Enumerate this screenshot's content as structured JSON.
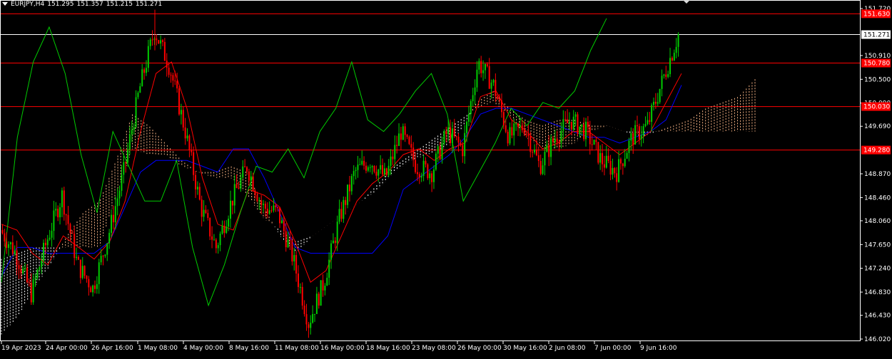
{
  "header": {
    "symbol": "EURJPY,H4",
    "open": "151.295",
    "high": "151.357",
    "low": "151.215",
    "close": "151.271"
  },
  "colors": {
    "background": "#000000",
    "candle_up": "#00cc00",
    "candle_down": "#ff0000",
    "tenkan": "#ff0000",
    "kijun": "#0000ff",
    "chikou": "#00cc00",
    "cloud_bull": "#f4b183",
    "cloud_bear": "#ffffff",
    "level_line": "#ff0000",
    "price_line": "#ffffff"
  },
  "chart_data": {
    "type": "candlestick",
    "symbol": "EURJPY",
    "timeframe": "H4",
    "ylim": [
      146.02,
      151.72
    ],
    "y_ticks": [
      "151.720",
      "150.910",
      "150.500",
      "150.090",
      "149.690",
      "148.870",
      "148.460",
      "148.060",
      "147.650",
      "147.240",
      "146.830",
      "146.430",
      "146.020"
    ],
    "x_ticks": [
      "19 Apr 2023",
      "24 Apr 00:00",
      "26 Apr 16:00",
      "1 May 08:00",
      "4 May 00:00",
      "8 May 16:00",
      "11 May 08:00",
      "16 May 00:00",
      "18 May 16:00",
      "23 May 08:00",
      "26 May 00:00",
      "30 May 16:00",
      "2 Jun 08:00",
      "7 Jun 00:00",
      "9 Jun 16:00"
    ],
    "levels": [
      {
        "value": 151.63,
        "label": "151.630"
      },
      {
        "value": 150.78,
        "label": "150.780"
      },
      {
        "value": 150.03,
        "label": "150.030"
      },
      {
        "value": 149.28,
        "label": "149.280"
      }
    ],
    "current_price": {
      "value": 151.271,
      "label": "151.271"
    },
    "close_path": [
      147.9,
      147.5,
      146.8,
      147.7,
      148.5,
      147.3,
      146.9,
      147.8,
      148.9,
      150.3,
      151.35,
      150.7,
      149.6,
      148.3,
      147.6,
      148.4,
      149.0,
      148.3,
      148.2,
      147.4,
      146.3,
      147.0,
      148.1,
      148.9,
      149.1,
      148.8,
      149.6,
      149.0,
      148.9,
      149.6,
      149.3,
      150.8,
      150.4,
      149.5,
      149.7,
      149.0,
      149.5,
      149.8,
      149.6,
      149.1,
      148.9,
      149.5,
      149.7,
      150.5,
      151.271
    ],
    "tenkan_path": [
      148.0,
      147.9,
      147.5,
      147.3,
      147.8,
      147.6,
      147.4,
      147.7,
      148.4,
      149.6,
      150.6,
      150.8,
      150.0,
      148.8,
      148.0,
      147.9,
      148.6,
      148.5,
      148.3,
      147.7,
      147.0,
      147.2,
      147.8,
      148.4,
      148.7,
      148.9,
      149.2,
      149.3,
      149.1,
      149.3,
      149.4,
      150.2,
      150.3,
      149.8,
      149.6,
      149.3,
      149.4,
      149.6,
      149.6,
      149.4,
      149.2,
      149.4,
      149.6,
      150.1,
      150.6
    ],
    "kijun_path": [
      147.1,
      147.6,
      147.6,
      147.5,
      147.5,
      147.5,
      147.5,
      147.7,
      148.3,
      148.9,
      149.1,
      149.1,
      149.1,
      149.0,
      148.9,
      149.3,
      149.3,
      148.8,
      148.2,
      147.6,
      147.5,
      147.5,
      147.5,
      147.5,
      147.5,
      147.8,
      148.6,
      148.8,
      149.0,
      149.2,
      149.5,
      149.9,
      150.0,
      150.0,
      149.9,
      149.8,
      149.7,
      149.6,
      149.5,
      149.5,
      149.4,
      149.5,
      149.6,
      149.8,
      150.4
    ],
    "chikou_path": [
      147.0,
      149.5,
      150.8,
      151.4,
      150.6,
      149.2,
      148.2,
      149.6,
      149.0,
      148.4,
      148.4,
      149.1,
      147.6,
      146.6,
      147.3,
      148.2,
      149.0,
      148.9,
      149.3,
      148.8,
      149.6,
      150.0,
      150.8,
      149.8,
      149.6,
      149.9,
      150.3,
      150.6,
      149.9,
      148.4,
      148.9,
      149.4,
      150.0,
      149.7,
      150.1,
      150.0,
      150.3,
      151.0,
      151.55
    ],
    "cloud_a": [
      146.1,
      146.4,
      146.9,
      147.3,
      147.8,
      148.2,
      148.4,
      149.1,
      149.9,
      149.7,
      149.4,
      149.1,
      148.9,
      148.9,
      149.0,
      148.9,
      148.3,
      147.8,
      147.5,
      147.8,
      148.0,
      148.2,
      148.4,
      148.6,
      148.9,
      149.1,
      149.2,
      149.3,
      149.6,
      150.1,
      150.3,
      150.0,
      149.8,
      149.7,
      149.8,
      149.8,
      149.7,
      149.7,
      149.6,
      149.5,
      149.6,
      149.7,
      149.8,
      150.0,
      150.1,
      150.2,
      150.5
    ],
    "cloud_b": [
      147.4,
      147.5,
      147.6,
      147.6,
      147.6,
      147.6,
      147.6,
      148.5,
      149.3,
      149.2,
      149.2,
      149.0,
      148.9,
      148.8,
      148.8,
      148.5,
      148.1,
      147.9,
      147.7,
      147.8,
      148.0,
      148.2,
      148.4,
      148.7,
      149.0,
      149.2,
      149.4,
      149.6,
      149.8,
      150.0,
      150.1,
      149.9,
      149.5,
      149.3,
      149.3,
      149.4,
      149.6,
      149.7,
      149.6,
      149.6,
      149.6,
      149.6,
      149.6,
      149.6,
      149.6,
      149.6,
      149.6
    ]
  }
}
